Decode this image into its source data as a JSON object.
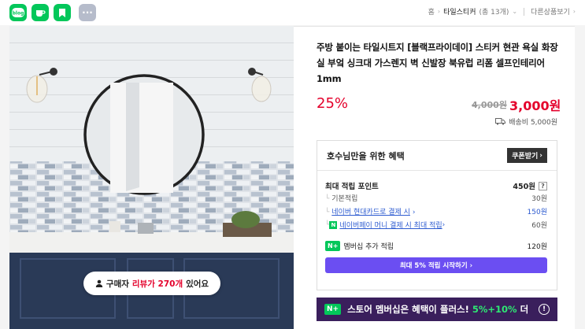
{
  "share_icons": [
    {
      "name": "blog-share-icon",
      "label": "blog",
      "color": "#03c75a"
    },
    {
      "name": "cafe-share-icon",
      "label": "",
      "color": "#03c75a"
    },
    {
      "name": "bookmark-share-icon",
      "label": "",
      "color": "#03c75a"
    },
    {
      "name": "more-share-icon",
      "label": "···",
      "color": "#b6bccb"
    }
  ],
  "breadcrumb": {
    "home": "홈",
    "category": "타일스티커",
    "count": "(총 13개)",
    "other": "다른상품보기"
  },
  "product": {
    "title": "주방 붙이는 타일시트지 [블랙프라이데이] 스티커 현관 욕실 화장실 부엌 싱크대 가스렌지 벽 신발장 북유럽 리폼 셀프인테리어 1mm",
    "discount": "25%",
    "original_price": "4,000원",
    "price": "3,000원",
    "shipping": "배송비 5,000원"
  },
  "review_pill": {
    "prefix": "구매자",
    "highlight": "리뷰가 270개",
    "suffix": "있어요"
  },
  "benefit": {
    "title": "호수님만을 위한 혜택",
    "coupon_label": "쿠폰받기",
    "max_points_label": "최대 적립 포인트",
    "max_points_value": "450원",
    "help_label": "?",
    "rows": [
      {
        "label": "기본적립",
        "value": "30원",
        "type": "plain"
      },
      {
        "label": "네이버 현대카드로 결제 시",
        "value": "150원",
        "type": "link"
      },
      {
        "label": "네이버페이 머니 결제 시 최대 적립",
        "value": "60원",
        "type": "npay"
      }
    ],
    "member_label": "멤버십 추가 적립",
    "member_badge": "N+",
    "member_value": "120원",
    "start_button": "최대 5% 적립 시작하기 ›"
  },
  "banner": {
    "badge": "N+",
    "text": "스토어 멤버십은 혜택이 플러스!",
    "highlight": "5%+10%",
    "suffix": "더",
    "color": "#3a1f5c"
  },
  "colors": {
    "accent_red": "#e4002b",
    "naver_green": "#03c75a",
    "button_purple": "#6b4ef2"
  }
}
